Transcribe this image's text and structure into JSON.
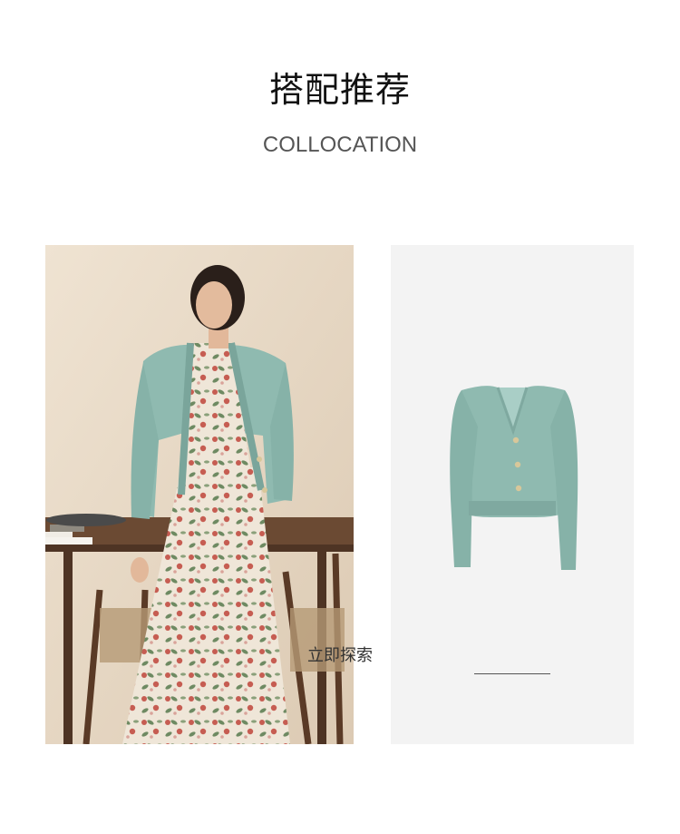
{
  "header": {
    "title": "搭配推荐",
    "subtitle": "COLLOCATION"
  },
  "product": {
    "cta_label": "立即探索"
  },
  "colors": {
    "cardigan": "#8fbab0",
    "product_bg": "#f3f3f3",
    "wall": "#e8dbc8"
  }
}
